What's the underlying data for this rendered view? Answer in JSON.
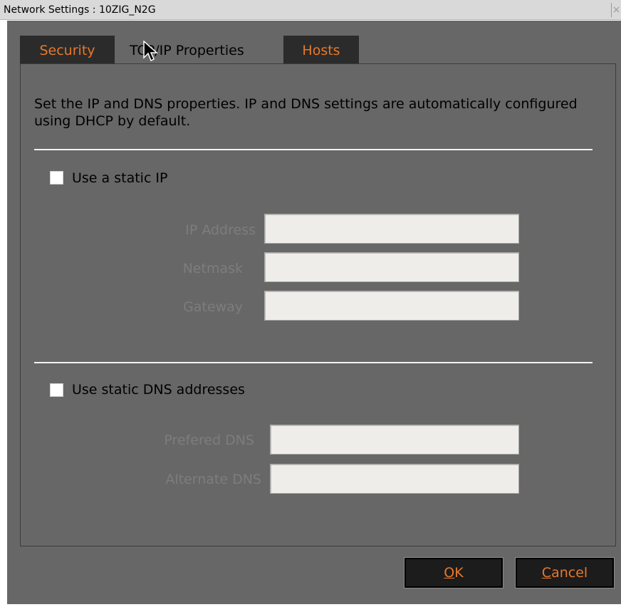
{
  "window": {
    "title": "Network Settings : 10ZIG_N2G",
    "close_glyph": "×"
  },
  "tabs": [
    {
      "label": "Security",
      "active": false
    },
    {
      "label": "TCP/IP Properties",
      "active": true
    },
    {
      "label": "Hosts",
      "active": false
    }
  ],
  "panel": {
    "description": "Set the IP and DNS properties. IP and DNS settings are automatically configured using DHCP by default.",
    "static_ip": {
      "checkbox_label": "Use a static IP",
      "checked": false,
      "fields": [
        {
          "label": "IP Address",
          "value": ""
        },
        {
          "label": "Netmask",
          "value": ""
        },
        {
          "label": "Gateway",
          "value": ""
        }
      ]
    },
    "static_dns": {
      "checkbox_label": "Use static DNS addresses",
      "checked": false,
      "fields": [
        {
          "label": "Prefered DNS",
          "value": ""
        },
        {
          "label": "Alternate DNS",
          "value": ""
        }
      ]
    }
  },
  "buttons": {
    "ok": {
      "mnemonic": "O",
      "rest": "K"
    },
    "cancel": {
      "mnemonic": "C",
      "rest": "ancel"
    }
  },
  "colors": {
    "dialog_bg": "#676767",
    "accent": "#e8782a",
    "tab_dark": "#2b2b2b"
  }
}
